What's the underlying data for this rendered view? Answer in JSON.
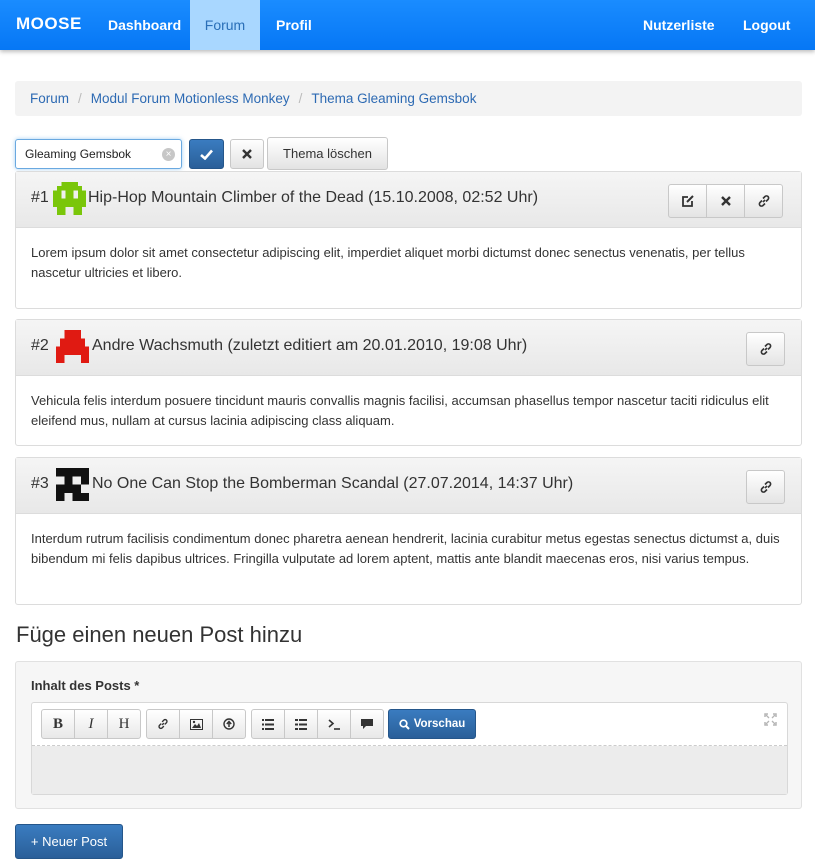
{
  "navbar": {
    "brand": "MOOSE",
    "items": [
      {
        "label": "Dashboard"
      },
      {
        "label": "Forum",
        "active": true
      },
      {
        "label": "Profil"
      }
    ],
    "right_items": [
      {
        "label": "Nutzerliste"
      },
      {
        "label": "Logout"
      }
    ],
    "color": "#0a84ff"
  },
  "breadcrumb": [
    "Forum",
    "Modul Forum Motionless Monkey",
    "Thema Gleaming Gemsbok"
  ],
  "edit_bar": {
    "title_value": "Gleaming Gemsbok",
    "delete_label": "Thema löschen"
  },
  "posts": [
    {
      "number": "#1",
      "title": "Hip-Hop Mountain Climber of the Dead (15.10.2008, 02:52 Uhr)",
      "body": "Lorem ipsum dolor sit amet consectetur adipiscing elit, imperdiet aliquet morbi dictumst donec senectus venenatis, per tellus nascetur ultricies et libero.",
      "avatar_color": "#7ac60a",
      "actions": [
        "edit-icon",
        "delete-icon",
        "link-icon"
      ]
    },
    {
      "number": "#2",
      "title": "Andre Wachsmuth (zuletzt editiert am 20.01.2010, 19:08 Uhr)",
      "body": "Vehicula felis interdum posuere tincidunt mauris convallis magnis facilisi, accumsan phasellus tempor nascetur taciti ridiculus elit eleifend mus, nullam at cursus lacinia adipiscing class aliquam.",
      "avatar_color": "#e01a12",
      "actions": [
        "link-icon"
      ]
    },
    {
      "number": "#3",
      "title": "No One Can Stop the Bomberman Scandal (27.07.2014, 14:37 Uhr)",
      "body": "Interdum rutrum facilisis condimentum donec pharetra aenean hendrerit, lacinia curabitur metus egestas senectus dictumst a, duis bibendum mi felis dapibus ultrices. Fringilla vulputate ad lorem aptent, mattis ante blandit maecenas eros, nisi varius tempus.",
      "avatar_color": "#111111",
      "actions": [
        "link-icon"
      ]
    }
  ],
  "new_post": {
    "heading": "Füge einen neuen Post hinzu",
    "label": "Inhalt des Posts *",
    "toolbar": {
      "bold": "B",
      "italic": "I",
      "heading": "H",
      "preview": "Vorschau"
    },
    "submit_label": "+ Neuer Post"
  }
}
